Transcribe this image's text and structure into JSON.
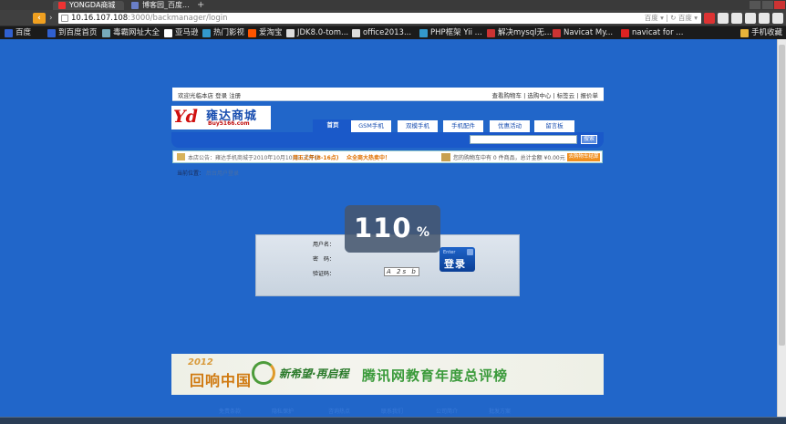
{
  "browser": {
    "tabs": [
      {
        "title": "YONGDA商城",
        "close": "×"
      },
      {
        "title": "博客园_百度...",
        "close": "×"
      }
    ],
    "new_tab": "+",
    "back_arrow": "‹",
    "forward_arrow": "›",
    "url_host": "10.16.107.108",
    "url_path": ":3000/backmanager/login",
    "url_right": "百度 ▾ | ↻ 百度 ▾",
    "bookmarks": [
      "百度",
      "到百度首页",
      "毒霸网址大全",
      "亚马逊",
      "热门影视",
      "爱淘宝",
      "JDK8.0-tom...",
      "office2013...",
      "PHP框架 Yii ...",
      "解决mysql无...",
      "Navicat My...",
      "navicat for ...",
      "手机收藏"
    ]
  },
  "site": {
    "welcome_prefix": "欢迎光临本店",
    "login_link": "登录",
    "register_link": "注册",
    "top_links": [
      "查看购物车",
      "选购中心",
      "标签云",
      "报价单"
    ],
    "logo_mark": "Yd",
    "logo_name": "雍达商城",
    "logo_domain": "Buy5166.com",
    "nav": [
      "首页",
      "GSM手机",
      "双模手机",
      "手机配件",
      "优惠活动",
      "留言板"
    ],
    "search_button": "搜索",
    "notice_1": "本店公告：雍达手机商城于2010年10月10日正式开业",
    "notice_2": "用五上午(8-16点)",
    "notice_3": "众全商大热卖中！",
    "cart_text": "您的购物车中有 0 件商品，总计金额 ¥0.00元",
    "view_cart": "去购物车结算",
    "breadcrumb_label": "当前位置：",
    "breadcrumb_current": "后台用户登录",
    "login": {
      "username_label": "用户名：",
      "password_label": "密　码：",
      "captcha_label": "验证码：",
      "captcha_text": "A 2s b",
      "enter_small": "Enter",
      "enter_big": "登录"
    },
    "zoom_value": "110",
    "zoom_unit": "%",
    "banner": {
      "year": "2012",
      "headline": "回响中国",
      "slogan": "新希望·再启程",
      "title": "腾讯网教育年度总评榜"
    },
    "footer_links": [
      "免责条款",
      "隐私保护",
      "咨询热点",
      "联系我们",
      "公司简介",
      "批发方案"
    ]
  },
  "colors": {
    "page_bg": "#2166c9",
    "nav_blue": "#1a59c9",
    "accent_orange": "#f09020"
  }
}
